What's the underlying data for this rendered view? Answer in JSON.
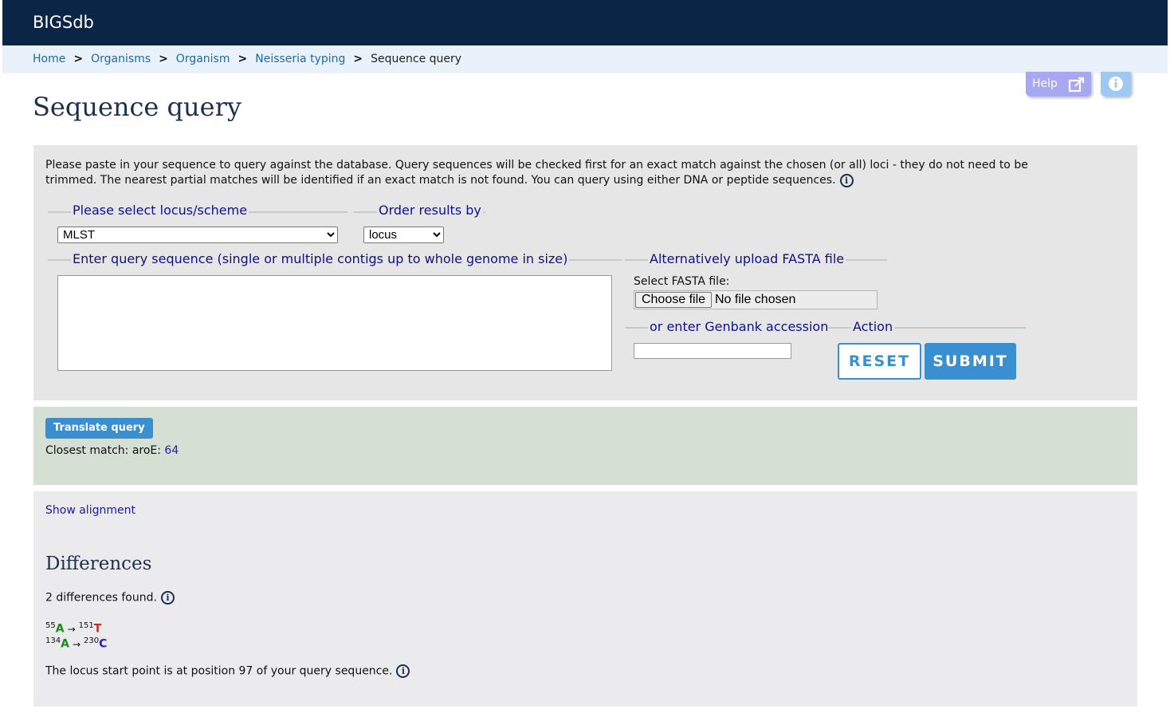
{
  "app": {
    "title": "BIGSdb"
  },
  "breadcrumb": [
    {
      "label": "Home"
    },
    {
      "label": "Organisms"
    },
    {
      "label": "Organism"
    },
    {
      "label": "Neisseria typing"
    },
    {
      "label": "Sequence query"
    }
  ],
  "toolbar": {
    "help_label": "Help"
  },
  "page": {
    "title": "Sequence query"
  },
  "query": {
    "intro": "Please paste in your sequence to query against the database. Query sequences will be checked first for an exact match against the chosen (or all) loci - they do not need to be trimmed. The nearest partial matches will be identified if an exact match is not found. You can query using either DNA or peptide sequences.",
    "locus_legend": "Please select locus/scheme",
    "locus_value": "MLST",
    "order_legend": "Order results by",
    "order_value": "locus",
    "sequence_legend": "Enter query sequence (single or multiple contigs up to whole genome in size)",
    "sequence_value": "",
    "upload_legend": "Alternatively upload FASTA file",
    "file_label": "Select FASTA file:",
    "choose_file": "Choose file",
    "no_file": "No file chosen",
    "genbank_legend": "or enter Genbank accession",
    "genbank_value": "",
    "action_legend": "Action",
    "reset_label": "RESET",
    "submit_label": "SUBMIT"
  },
  "result": {
    "translate_label": "Translate query",
    "closest_prefix": "Closest match: aroE: ",
    "closest_allele": "64"
  },
  "details": {
    "show_alignment": "Show alignment",
    "differences_title": "Differences",
    "differences_count": "2 differences found.",
    "differences": [
      {
        "query_pos": "55",
        "query_base": "A",
        "ref_pos": "151",
        "ref_base": "T",
        "query_color": "#1a8a1a",
        "ref_color": "#e02020"
      },
      {
        "query_pos": "134",
        "query_base": "A",
        "ref_pos": "230",
        "ref_base": "C",
        "query_color": "#1a8a1a",
        "ref_color": "#2222cc"
      }
    ],
    "locus_start": "The locus start point is at position 97 of your query sequence."
  },
  "colors": {
    "header_bg": "#0b2547",
    "breadcrumb_bg": "#e9f1fb",
    "accent": "#3a8fd0",
    "legend": "#10108a",
    "result_bg": "#d5dfd4"
  }
}
